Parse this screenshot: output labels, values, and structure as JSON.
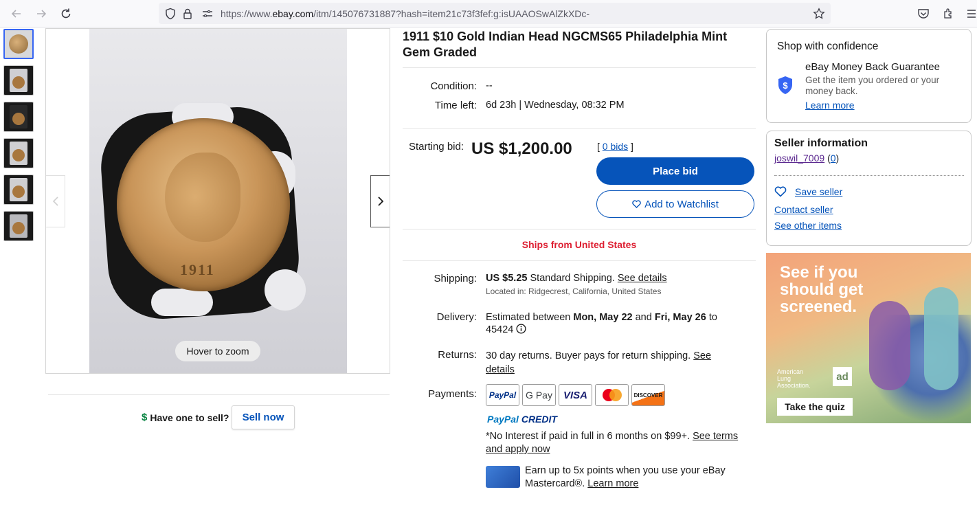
{
  "browser": {
    "url_prefix": "https://www.",
    "url_host": "ebay.com",
    "url_rest": "/itm/145076731887?hash=item21c73f3fef:g:isUAAOSwAlZkXDc-"
  },
  "gallery": {
    "hover_label": "Hover to zoom",
    "have_one_label": "Have one to sell?",
    "sell_now_label": "Sell now"
  },
  "item": {
    "title": "1911 $10 Gold Indian Head NGCMS65 Philadelphia Mint Gem Graded",
    "condition_label": "Condition:",
    "condition_value": "--",
    "time_left_label": "Time left:",
    "time_left_value": "6d 23h | Wednesday, 08:32 PM",
    "starting_bid_label": "Starting bid:",
    "price": "US $1,200.00",
    "bids_open": "[",
    "bids_link": "0 bids",
    "bids_close": "]",
    "place_bid_label": "Place bid",
    "watchlist_label": "Add to Watchlist",
    "ships_from": "Ships from United States",
    "shipping_label": "Shipping:",
    "shipping_price": "US $5.25",
    "shipping_method": "Standard Shipping.",
    "shipping_details_link": "See details",
    "located_in": "Located in: Ridgecrest, California, United States",
    "delivery_label": "Delivery:",
    "delivery_prefix": "Estimated between",
    "delivery_start": "Mon, May 22",
    "delivery_and": "and",
    "delivery_end": "Fri, May 26",
    "delivery_to": "to",
    "delivery_zip": "45424",
    "returns_label": "Returns:",
    "returns_text": "30 day returns. Buyer pays for return shipping.",
    "returns_see": "See",
    "returns_details": "details",
    "payments_label": "Payments:",
    "pay_methods": [
      "PayPal",
      "G Pay",
      "VISA",
      "Mastercard",
      "DISCOVER"
    ],
    "paypal_credit_a": "PayPal",
    "paypal_credit_b": "CREDIT",
    "no_interest_text": "*No Interest if paid in full in 6 months on $99+.",
    "see_terms_link": "See terms",
    "apply_now_link": "and apply now",
    "mastercard_text_1": "Earn up to 5x points when you use your eBay",
    "mastercard_text_2": "Mastercard®.",
    "learn_more_link": "Learn more"
  },
  "confidence": {
    "title": "Shop with confidence",
    "guarantee_title": "eBay Money Back Guarantee",
    "guarantee_text_1": "Get the item you ordered or your",
    "guarantee_text_2": "money back.",
    "learn_more": "Learn more"
  },
  "seller": {
    "title": "Seller information",
    "username": "joswil_7009",
    "feedback_open": "(",
    "feedback": "0",
    "feedback_close": ")",
    "save_seller": "Save seller",
    "contact_seller": "Contact seller",
    "other_items": "See other items"
  },
  "ad": {
    "headline": "See if you should get screened.",
    "org_1": "American",
    "org_2": "Lung",
    "org_3": "Association.",
    "logo": "ad",
    "cta": "Take the quiz"
  },
  "colors": {
    "ebay_blue": "#0654ba",
    "ships_red": "#dd1e31",
    "accent": "#3665f3"
  }
}
